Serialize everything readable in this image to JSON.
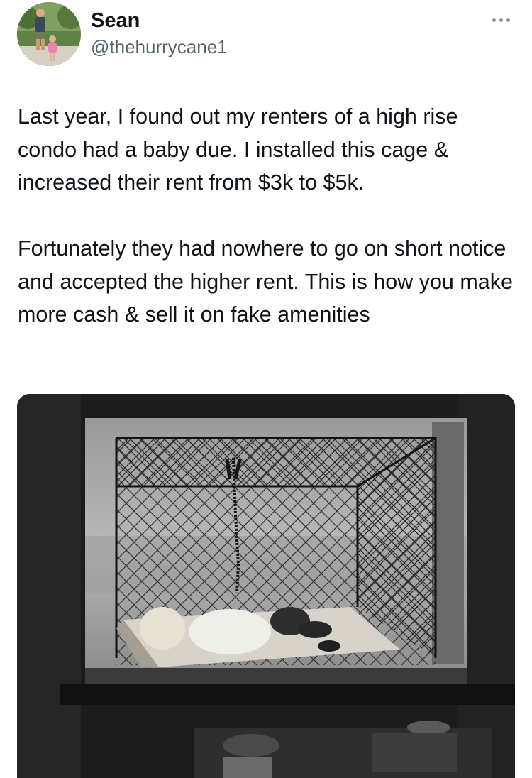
{
  "author": {
    "display_name": "Sean",
    "handle": "@thehurrycane1"
  },
  "tweet": {
    "paragraph_1": "Last year, I found out my renters of a high rise condo had a baby due. I installed this cage & increased their rent from $3k to $5k.",
    "paragraph_2": "Fortunately they had nowhere to go on short notice and accepted the higher rent. This is how you make more cash & sell it on fake amenities"
  },
  "icons": {
    "more": "more-horizontal-icon"
  }
}
